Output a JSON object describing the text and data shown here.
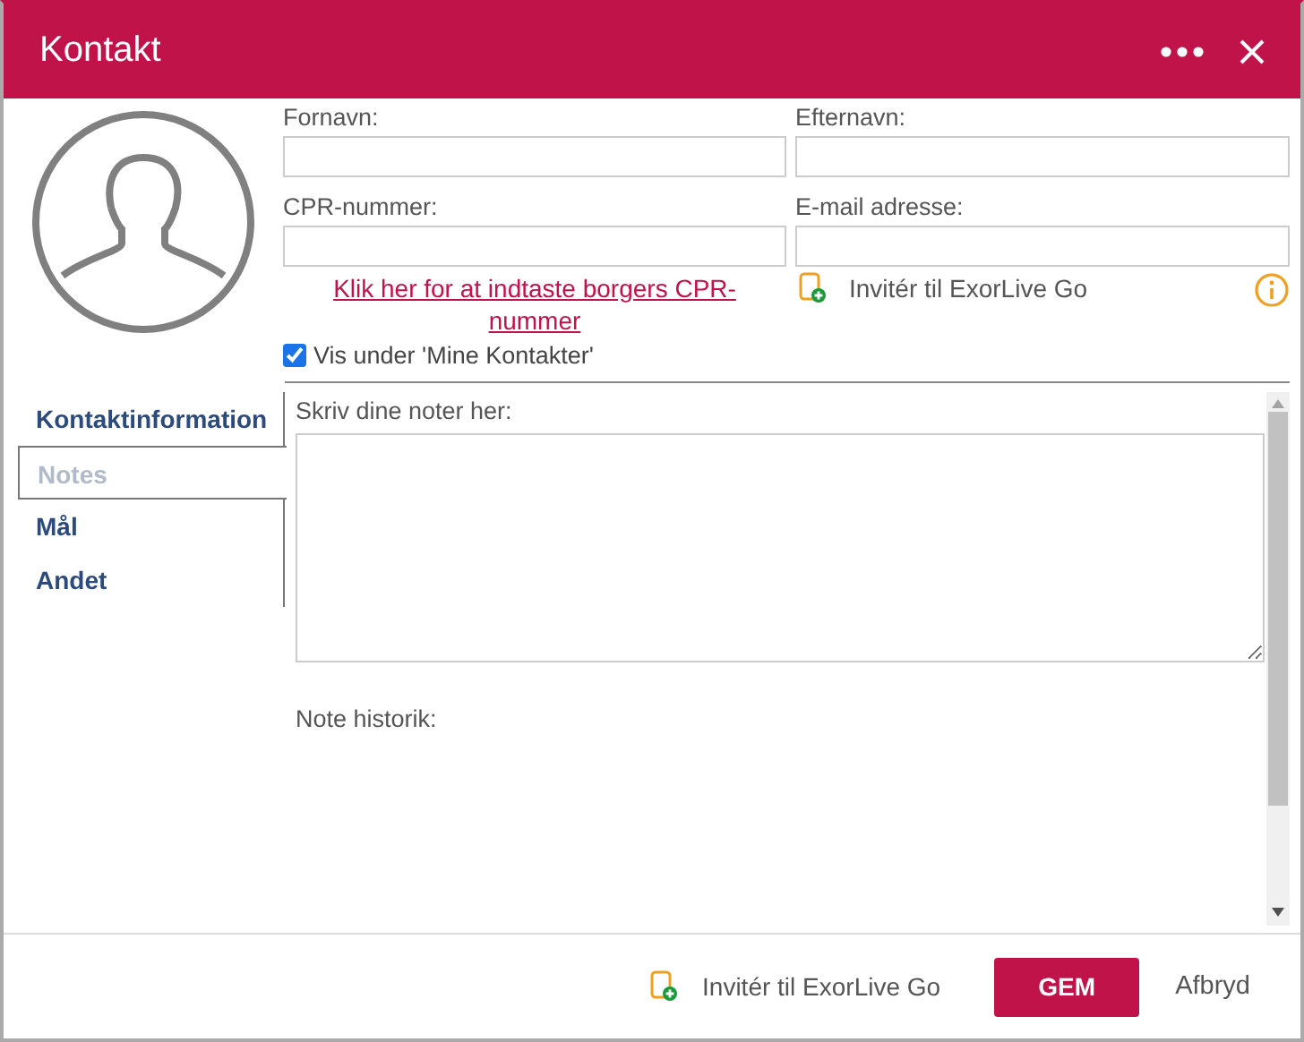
{
  "window": {
    "title": "Kontakt"
  },
  "fields": [
    {
      "label": "Fornavn:"
    },
    {
      "label": "Efternavn:"
    },
    {
      "label": "CPR-nummer:"
    },
    {
      "label": "E-mail adresse:"
    }
  ],
  "cpr_link": "Klik her for at indtaste borgers CPR-nummer",
  "invite_link": "Invitér til ExorLive Go",
  "show_in_contacts": {
    "label": "Vis under 'Mine Kontakter'",
    "checked": true
  },
  "tabs": [
    {
      "label": "Kontaktinformation",
      "selected": false
    },
    {
      "label": "Notes",
      "selected": true
    },
    {
      "label": "Mål",
      "selected": false
    },
    {
      "label": "Andet",
      "selected": false
    }
  ],
  "notes": {
    "label": "Skriv dine noter her:",
    "history_label": "Note historik:"
  },
  "footer": {
    "invite": "Invitér til ExorLive Go",
    "save": "GEM",
    "cancel": "Afbryd"
  }
}
